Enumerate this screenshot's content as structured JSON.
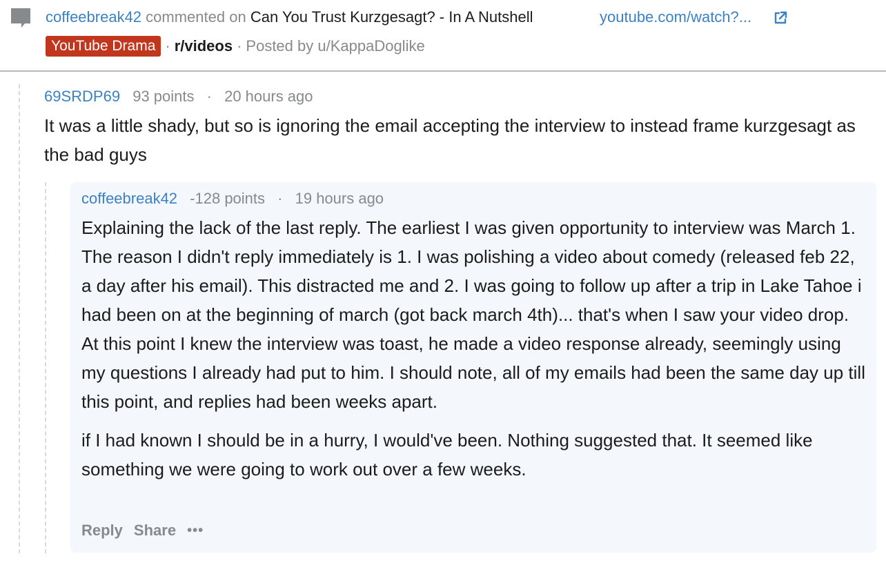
{
  "header": {
    "commenter": "coffeebreak42",
    "commented_on": "commented on",
    "post_title": "Can You Trust Kurzgesagt? - In A Nutshell",
    "link_text": "youtube.com/watch?...",
    "flair": "YouTube Drama",
    "subreddit": "r/videos",
    "posted_by": "Posted by u/KappaDoglike"
  },
  "parent_comment": {
    "author": "69SRDP69",
    "points": "93 points",
    "time": "20 hours ago",
    "body": "It was a little shady, but so is ignoring the email accepting the interview to instead frame kurzgesagt as the bad guys"
  },
  "reply_comment": {
    "author": "coffeebreak42",
    "points": "-128 points",
    "time": "19 hours ago",
    "paragraphs": [
      "Explaining the lack of the last reply. The earliest I was given opportunity to interview was March 1. The reason I didn't reply immediately is 1. I was polishing a video about comedy (released feb 22, a day after his email). This distracted me and 2. I was going to follow up after a trip in Lake Tahoe i had been on at the beginning of march (got back march 4th)... that's when I saw your video drop. At this point I knew the interview was toast, he made a video response already, seemingly using my questions I already had put to him. I should note, all of my emails had been the same day up till this point, and replies had been weeks apart.",
      "if I had known I should be in a hurry, I would've been. Nothing suggested that. It seemed like something we were going to work out over a few weeks."
    ],
    "actions": {
      "reply": "Reply",
      "share": "Share",
      "more": "•••"
    }
  },
  "separators": {
    "dot": "·"
  },
  "colors": {
    "link": "#3b82c4",
    "flair_bg": "#c1371d",
    "muted": "#878a8c",
    "reply_bg": "#f4f7fb"
  },
  "icons": {
    "comment": "comment-icon",
    "external_link": "external-link-icon"
  }
}
